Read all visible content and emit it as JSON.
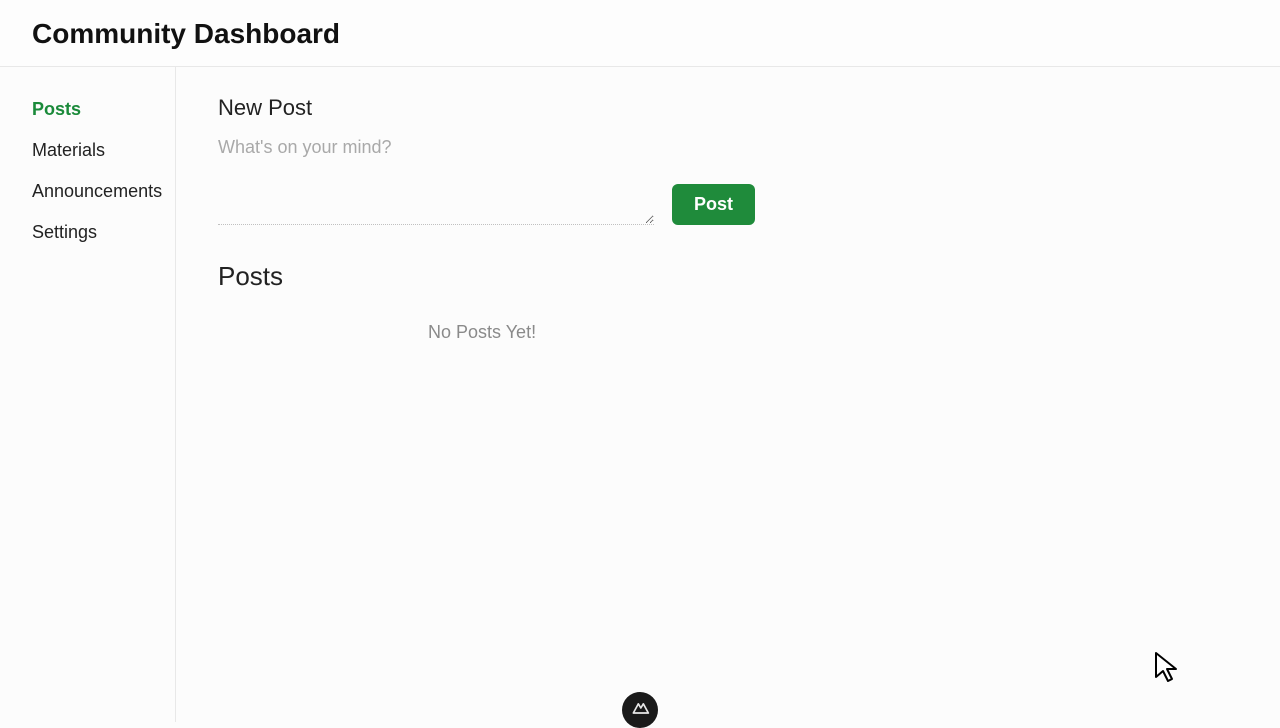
{
  "header": {
    "title": "Community Dashboard"
  },
  "sidebar": {
    "items": [
      {
        "label": "Posts",
        "active": true
      },
      {
        "label": "Materials",
        "active": false
      },
      {
        "label": "Announcements",
        "active": false
      },
      {
        "label": "Settings",
        "active": false
      }
    ]
  },
  "new_post": {
    "heading": "New Post",
    "placeholder": "What's on your mind?",
    "button_label": "Post"
  },
  "posts": {
    "heading": "Posts",
    "empty_message": "No Posts Yet!"
  },
  "colors": {
    "accent": "#1f8b3b",
    "sidebar_active": "#1a8a3a"
  }
}
